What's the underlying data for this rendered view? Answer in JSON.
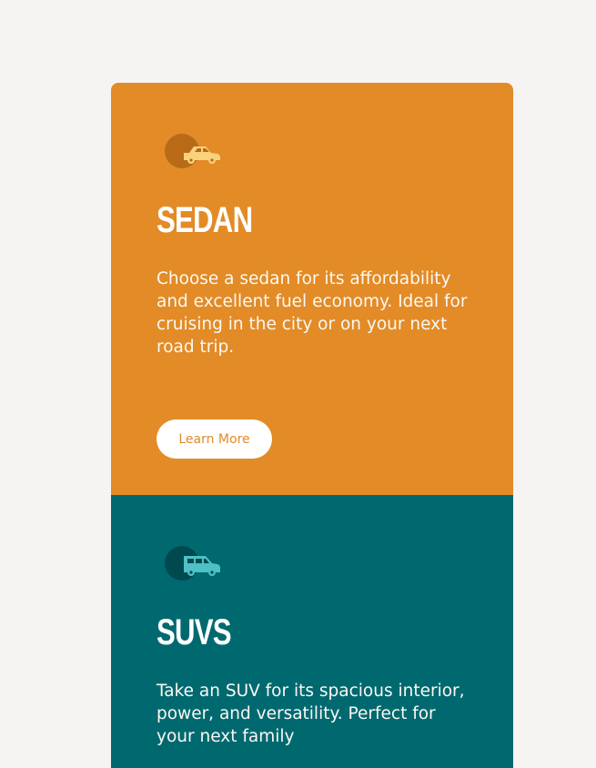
{
  "colors": {
    "page_background": "#f5f4f2",
    "sedan_background": "#e28b27",
    "sedan_icon_circle": "#b86a18",
    "sedan_icon_car": "#fbd27c",
    "suv_background": "#006970",
    "suv_icon_circle": "#004a4f",
    "suv_icon_car": "#4ec0c6",
    "button_background": "#ffffff"
  },
  "cards": [
    {
      "id": "sedan",
      "icon": "sedan-car-icon",
      "title": "SEDAN",
      "description": "Choose a sedan for its affordability and excellent fuel economy. Ideal for cruising in the city or on your next road trip.",
      "button_label": "Learn More"
    },
    {
      "id": "suvs",
      "icon": "suv-car-icon",
      "title": "SUVS",
      "description": "Take an SUV for its spacious interior, power, and versatility. Perfect for your next family",
      "button_label": ""
    }
  ]
}
